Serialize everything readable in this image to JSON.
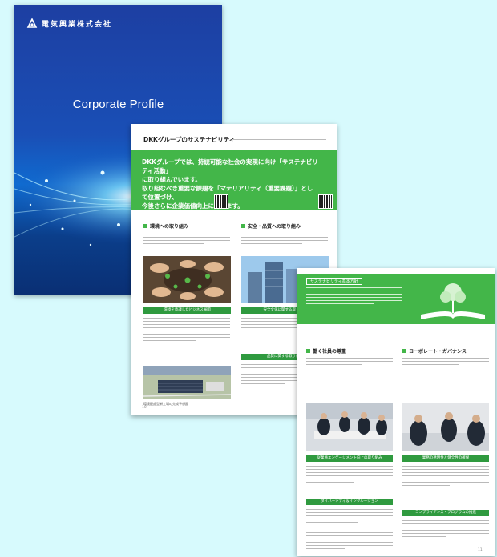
{
  "cover": {
    "company_name": "電気興業株式会社",
    "title": "Corporate Profile",
    "colors": {
      "top": "#1d3fa2",
      "bottom": "#0a2f74",
      "glow": "#8fe9ff"
    }
  },
  "page2": {
    "header": "DKKグループのサステナビリティ",
    "lead": [
      "DKKグループでは、持続可能な社会の実現に向け「サステナビリティ活動」",
      "に取り組んでいます。",
      "取り組むべき重要な課題を「マテリアリティ（重要課題）」として位置づけ、",
      "今後さらに企業価値向上に努めます。"
    ],
    "section_left": "環境への取り組み",
    "section_right": "安全・品質への取り組み",
    "caption_left": "環境を意識したビジネス展開",
    "caption_right": "安全文化に関する取り組み",
    "caption_right_2": "品質に関する取り組み",
    "photo_caption": "環境配慮型新工場の完成予想図",
    "page_number": "10"
  },
  "page3": {
    "banner_label": "サステナビリティ基本方針",
    "section_left": "働く社員の尊重",
    "section_right": "コーポレート・ガバナンス",
    "caption_left": "従業員エンゲージメント向上の取り組み",
    "caption_right": "業務の透明性と健全性の確保",
    "caption_left_2": "ダイバーシティ＆インクルージョン",
    "caption_right_2": "コンプライアンス・プログラムの推進",
    "page_number": "11"
  },
  "accent_green": "#43b649",
  "background": "#d7fafd"
}
